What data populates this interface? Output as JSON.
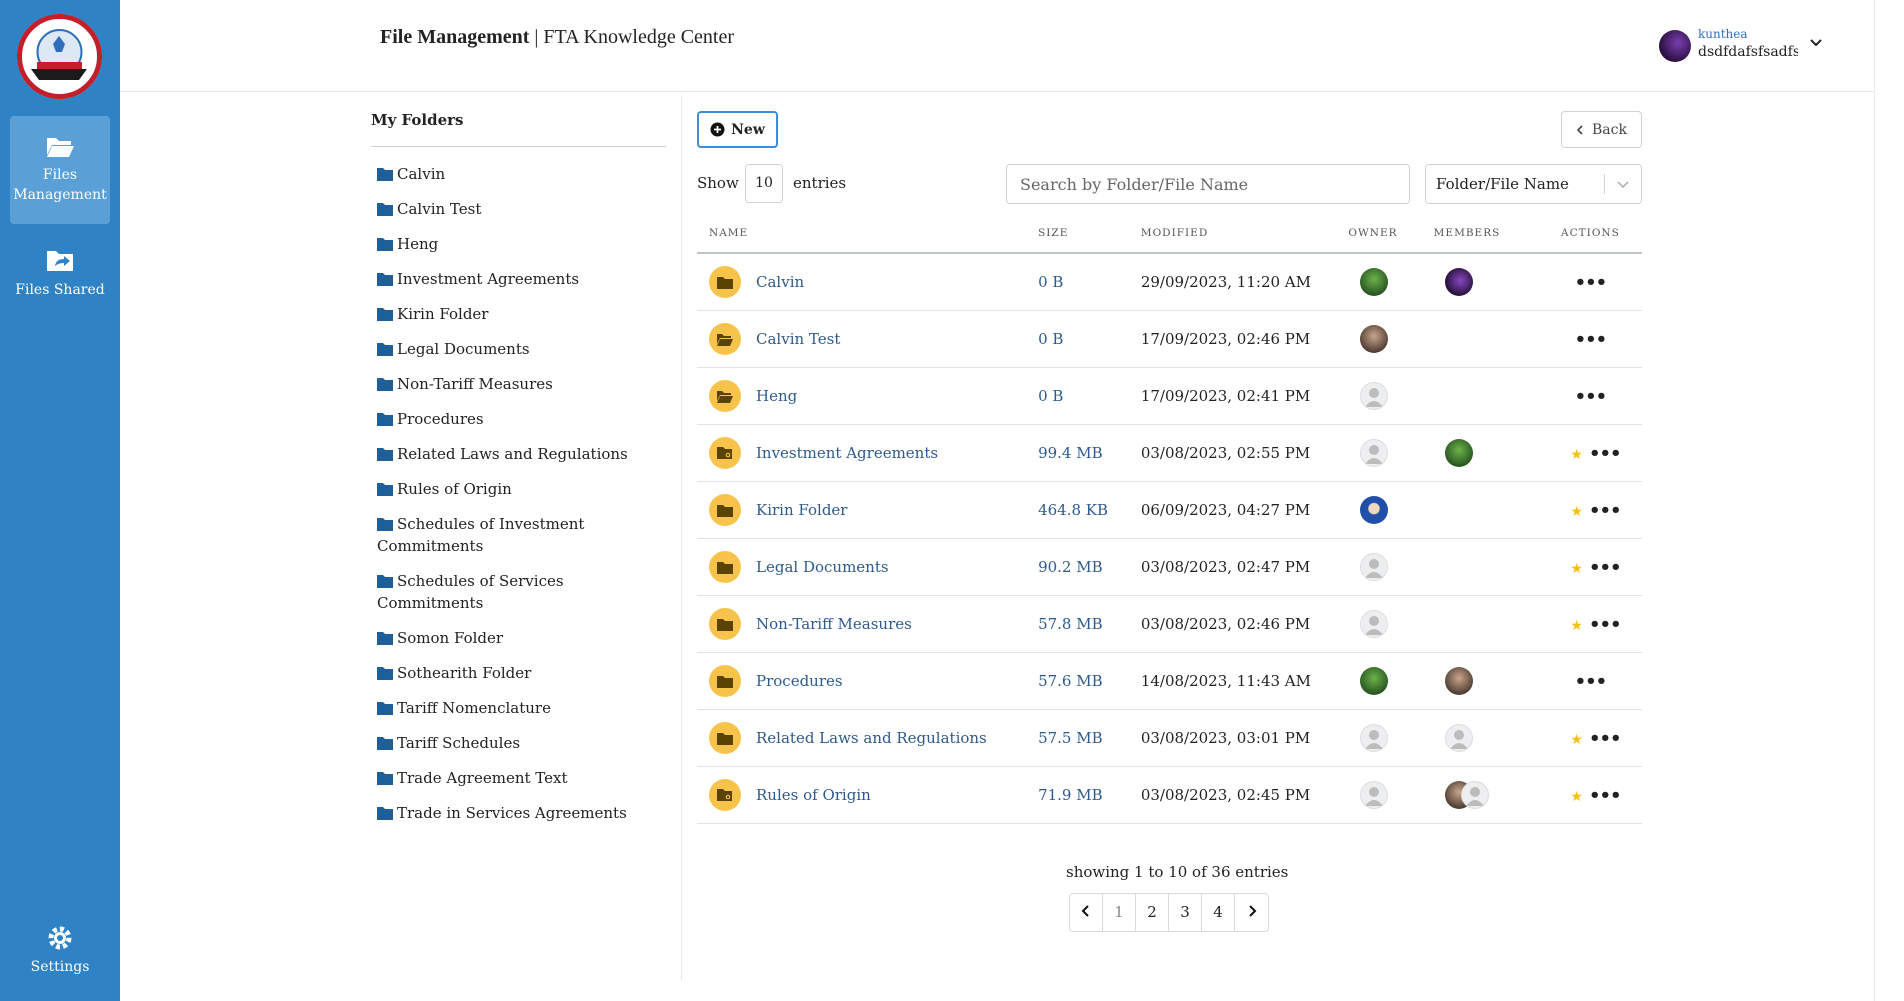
{
  "header": {
    "title_bold": "File Management",
    "title_sep": "|",
    "title_rest": "FTA Knowledge Center"
  },
  "user": {
    "name": "kunthea",
    "subtitle": "dsdfdafsfsadfsa"
  },
  "sidebar": {
    "items": [
      {
        "label": "Files Management",
        "icon": "folder-open-icon",
        "active": true
      },
      {
        "label": "Files Shared",
        "icon": "folder-share-icon",
        "active": false
      }
    ],
    "settings_label": "Settings"
  },
  "tree": {
    "title": "My Folders",
    "folders": [
      "Calvin",
      "Calvin Test",
      "Heng",
      "Investment Agreements",
      "Kirin Folder",
      "Legal Documents",
      "Non-Tariff Measures",
      "Procedures",
      "Related Laws and Regulations",
      "Rules of Origin",
      "Schedules of Investment Commitments",
      "Schedules of Services Commitments",
      "Somon Folder",
      "Sothearith Folder",
      "Tariff Nomenclature",
      "Tariff Schedules",
      "Trade Agreement Text",
      "Trade in Services Agreements"
    ]
  },
  "toolbar": {
    "new_label": "New",
    "back_label": "Back",
    "show_label": "Show",
    "entries_value": "10",
    "entries_label": "entries",
    "search_placeholder": "Search by Folder/File Name",
    "filter_value": "Folder/File Name"
  },
  "table": {
    "headers": {
      "name": "NAME",
      "size": "SIZE",
      "modified": "MODIFIED",
      "owner": "OWNER",
      "members": "MEMBERS",
      "actions": "ACTIONS"
    },
    "rows": [
      {
        "name": "Calvin",
        "size": "0 B",
        "modified": "29/09/2023, 11:20 AM",
        "owner": "green",
        "members": [
          "purple"
        ],
        "starred": false,
        "icon": "folder-icon"
      },
      {
        "name": "Calvin Test",
        "size": "0 B",
        "modified": "17/09/2023, 02:46 PM",
        "owner": "brown",
        "members": [],
        "starred": false,
        "icon": "folder-open-icon"
      },
      {
        "name": "Heng",
        "size": "0 B",
        "modified": "17/09/2023, 02:41 PM",
        "owner": "default",
        "members": [],
        "starred": false,
        "icon": "folder-open-icon"
      },
      {
        "name": "Investment Agreements",
        "size": "99.4 MB",
        "modified": "03/08/2023, 02:55 PM",
        "owner": "default",
        "members": [
          "green"
        ],
        "starred": true,
        "icon": "folder-shared-icon"
      },
      {
        "name": "Kirin Folder",
        "size": "464.8 KB",
        "modified": "06/09/2023, 04:27 PM",
        "owner": "blue",
        "members": [],
        "starred": true,
        "icon": "folder-icon"
      },
      {
        "name": "Legal Documents",
        "size": "90.2 MB",
        "modified": "03/08/2023, 02:47 PM",
        "owner": "default",
        "members": [],
        "starred": true,
        "icon": "folder-icon"
      },
      {
        "name": "Non-Tariff Measures",
        "size": "57.8 MB",
        "modified": "03/08/2023, 02:46 PM",
        "owner": "default",
        "members": [],
        "starred": true,
        "icon": "folder-icon"
      },
      {
        "name": "Procedures",
        "size": "57.6 MB",
        "modified": "14/08/2023, 11:43 AM",
        "owner": "green",
        "members": [
          "brown"
        ],
        "starred": false,
        "icon": "folder-icon"
      },
      {
        "name": "Related Laws and Regulations",
        "size": "57.5 MB",
        "modified": "03/08/2023, 03:01 PM",
        "owner": "default",
        "members": [
          "default"
        ],
        "starred": true,
        "icon": "folder-icon"
      },
      {
        "name": "Rules of Origin",
        "size": "71.9 MB",
        "modified": "03/08/2023, 02:45 PM",
        "owner": "default",
        "members": [
          "brown",
          "default"
        ],
        "starred": true,
        "icon": "folder-shared-icon"
      }
    ]
  },
  "footer": {
    "showing_text": "showing 1 to 10 of 36 entries",
    "pages": [
      "1",
      "2",
      "3",
      "4"
    ],
    "current_page": "1"
  },
  "colors": {
    "sidebar": "#2f83c4",
    "folder_badge": "#f8c34b",
    "link": "#2e5a8c",
    "star": "#f4c20d"
  }
}
